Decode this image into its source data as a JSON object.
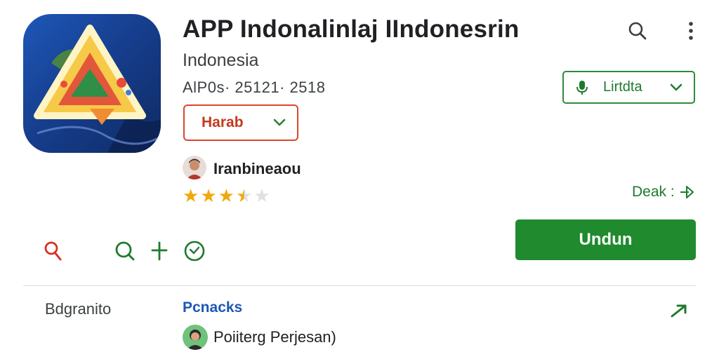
{
  "app": {
    "title": "APP Indonalinlaj IIndonesrin",
    "subtitle": "Indonesia",
    "meta": "AlP0s· 25121· 2518"
  },
  "header": {
    "search_icon": "search-icon",
    "more_icon": "more-vert-icon"
  },
  "red_dropdown": {
    "label": "Harab",
    "icon": "chevron-down-icon"
  },
  "green_dropdown": {
    "label": "Lirtdta",
    "icon": "microphone-icon"
  },
  "developer": {
    "name": "Iranbineaou"
  },
  "rating": {
    "value": 3.5,
    "max": 5
  },
  "deak": {
    "label": "Deak :",
    "icon": "share-icon"
  },
  "install": {
    "label": "Undun"
  },
  "actions": [
    "search-icon",
    "zoom-icon",
    "plus-icon",
    "clock-icon"
  ],
  "section": {
    "label": "Bdgranito",
    "link": "Pcnacks",
    "author": "Poiiterg Perjesan)"
  },
  "colors": {
    "accent_green": "#208a2e",
    "accent_red": "#d9472b",
    "link_blue": "#1b58b5"
  }
}
